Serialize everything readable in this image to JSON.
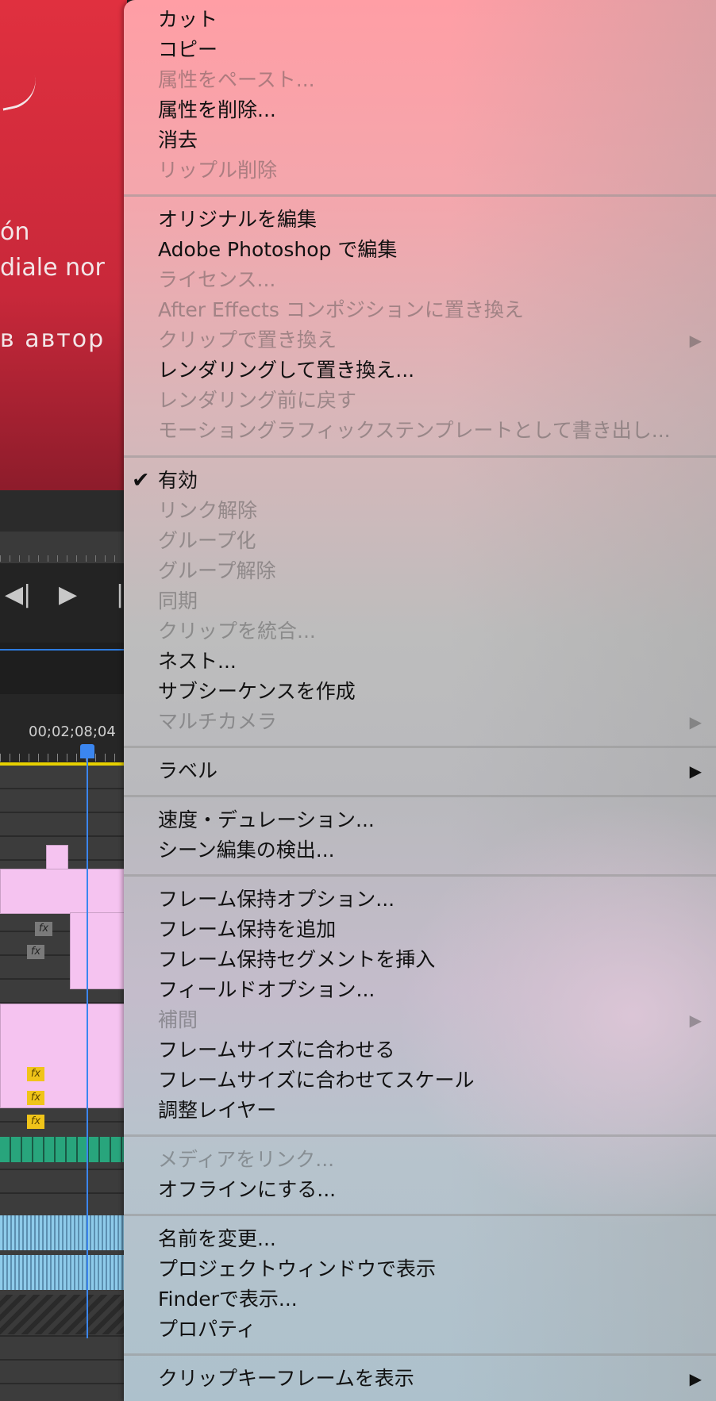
{
  "preview": {
    "text1": "ón",
    "text2": "diale nor",
    "text3": "в автор"
  },
  "timeline": {
    "timecode": "00;02;08;04"
  },
  "menu": {
    "items": [
      {
        "label": "カット",
        "enabled": true
      },
      {
        "label": "コピー",
        "enabled": true
      },
      {
        "label": "属性をペースト...",
        "enabled": false
      },
      {
        "label": "属性を削除...",
        "enabled": true
      },
      {
        "label": "消去",
        "enabled": true
      },
      {
        "label": "リップル削除",
        "enabled": false
      },
      {
        "label": "オリジナルを編集",
        "enabled": true
      },
      {
        "label": "Adobe Photoshop で編集",
        "enabled": true
      },
      {
        "label": "ライセンス...",
        "enabled": false
      },
      {
        "label": "After Effects コンポジションに置き換え",
        "enabled": false
      },
      {
        "label": "クリップで置き換え",
        "enabled": false,
        "submenu": true
      },
      {
        "label": "レンダリングして置き換え...",
        "enabled": true
      },
      {
        "label": "レンダリング前に戻す",
        "enabled": false
      },
      {
        "label": "モーショングラフィックステンプレートとして書き出し...",
        "enabled": false
      },
      {
        "label": "有効",
        "enabled": true,
        "checked": true
      },
      {
        "label": "リンク解除",
        "enabled": false
      },
      {
        "label": "グループ化",
        "enabled": false
      },
      {
        "label": "グループ解除",
        "enabled": false
      },
      {
        "label": "同期",
        "enabled": false
      },
      {
        "label": "クリップを統合...",
        "enabled": false
      },
      {
        "label": "ネスト...",
        "enabled": true
      },
      {
        "label": "サブシーケンスを作成",
        "enabled": true
      },
      {
        "label": "マルチカメラ",
        "enabled": false,
        "submenu": true
      },
      {
        "label": "ラベル",
        "enabled": true,
        "submenu": true
      },
      {
        "label": "速度・デュレーション...",
        "enabled": true
      },
      {
        "label": "シーン編集の検出...",
        "enabled": true
      },
      {
        "label": "フレーム保持オプション...",
        "enabled": true
      },
      {
        "label": "フレーム保持を追加",
        "enabled": true
      },
      {
        "label": "フレーム保持セグメントを挿入",
        "enabled": true
      },
      {
        "label": "フィールドオプション...",
        "enabled": true
      },
      {
        "label": "補間",
        "enabled": false,
        "submenu": true
      },
      {
        "label": "フレームサイズに合わせる",
        "enabled": true
      },
      {
        "label": "フレームサイズに合わせてスケール",
        "enabled": true
      },
      {
        "label": "調整レイヤー",
        "enabled": true
      },
      {
        "label": "メディアをリンク...",
        "enabled": false
      },
      {
        "label": "オフラインにする...",
        "enabled": true
      },
      {
        "label": "名前を変更...",
        "enabled": true
      },
      {
        "label": "プロジェクトウィンドウで表示",
        "enabled": true
      },
      {
        "label": "Finderで表示...",
        "enabled": true
      },
      {
        "label": "プロパティ",
        "enabled": true
      },
      {
        "label": "クリップキーフレームを表示",
        "enabled": true,
        "submenu": true
      }
    ]
  }
}
